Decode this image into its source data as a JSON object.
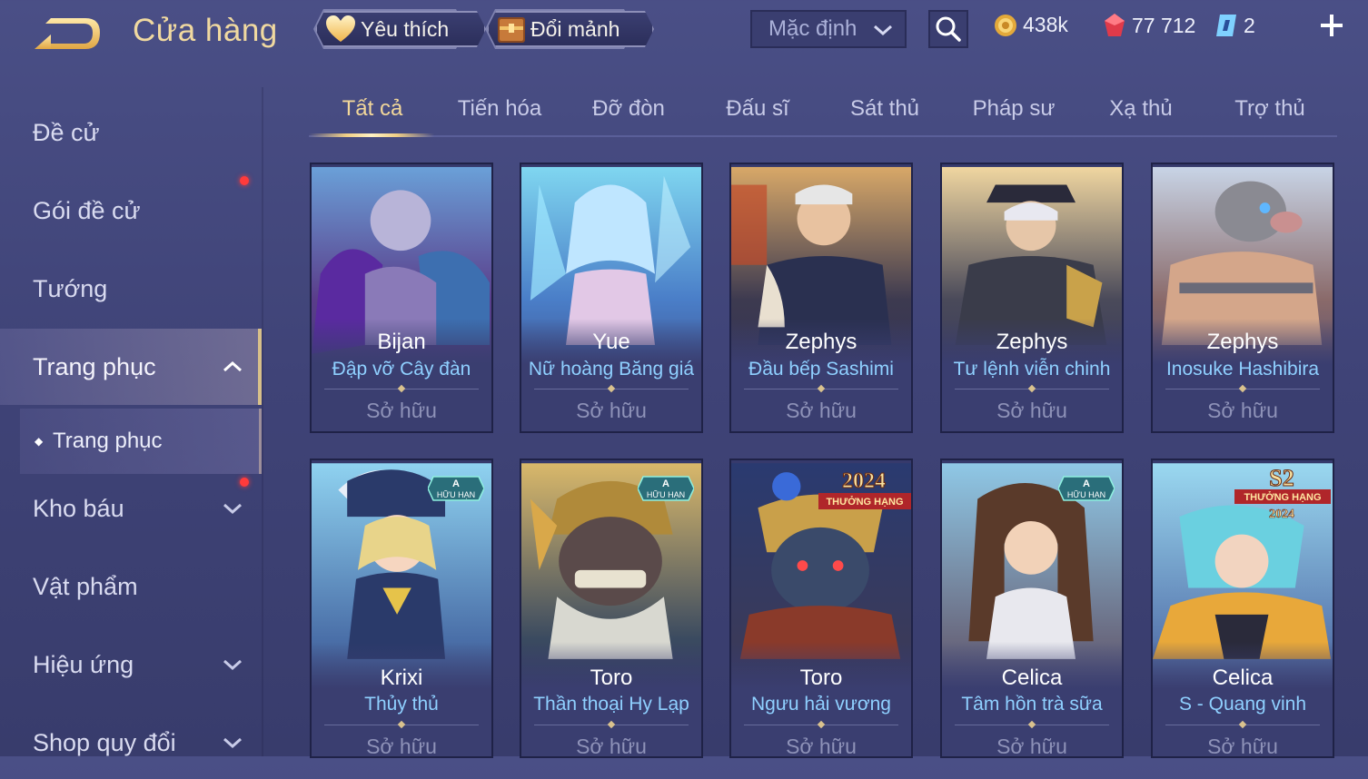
{
  "header": {
    "title": "Cửa hàng",
    "favorite_label": "Yêu thích",
    "fragment_label": "Đổi mảnh",
    "sort_value": "Mặc định",
    "gold": "438k",
    "gems": "77 712",
    "vouchers": "2"
  },
  "sidebar": {
    "items": [
      {
        "label": "Đề cử"
      },
      {
        "label": "Gói đề cử"
      },
      {
        "label": "Tướng"
      },
      {
        "label": "Trang phục"
      },
      {
        "label": "Trang phục"
      },
      {
        "label": "Kho báu"
      },
      {
        "label": "Vật phẩm"
      },
      {
        "label": "Hiệu ứng"
      },
      {
        "label": "Shop quy đổi"
      }
    ]
  },
  "tabs": [
    {
      "label": "Tất cả"
    },
    {
      "label": "Tiến hóa"
    },
    {
      "label": "Đỡ đòn"
    },
    {
      "label": "Đấu sĩ"
    },
    {
      "label": "Sát thủ"
    },
    {
      "label": "Pháp sư"
    },
    {
      "label": "Xạ thủ"
    },
    {
      "label": "Trợ thủ"
    }
  ],
  "cards": [
    {
      "hero": "Bijan",
      "skin": "Đập vỡ Cây đàn",
      "status": "Sở hữu"
    },
    {
      "hero": "Yue",
      "skin": "Nữ hoàng Băng giá",
      "status": "Sở hữu"
    },
    {
      "hero": "Zephys",
      "skin": "Đầu bếp Sashimi",
      "status": "Sở hữu"
    },
    {
      "hero": "Zephys",
      "skin": "Tư lệnh viễn chinh",
      "status": "Sở hữu"
    },
    {
      "hero": "Zephys",
      "skin": "Inosuke Hashibira",
      "status": "Sở hữu"
    },
    {
      "hero": "Krixi",
      "skin": "Thủy thủ",
      "status": "Sở hữu",
      "badge_top": "A",
      "badge_text": "HỮU HẠN"
    },
    {
      "hero": "Toro",
      "skin": "Thần thoại Hy Lạp",
      "status": "Sở hữu",
      "badge_top": "A",
      "badge_text": "HỮU HẠN"
    },
    {
      "hero": "Toro",
      "skin": "Ngưu hải vương",
      "status": "Sở hữu",
      "rank_top": "2024",
      "rank_text": "THƯỞNG HẠNG"
    },
    {
      "hero": "Celica",
      "skin": "Tâm hồn trà sữa",
      "status": "Sở hữu",
      "badge_top": "A",
      "badge_text": "HỮU HẠN"
    },
    {
      "hero": "Celica",
      "skin": "S - Quang vinh",
      "status": "Sở hữu",
      "rank_top": "S2",
      "rank_text": "THƯỞNG HẠNG",
      "rank_bottom": "2024"
    }
  ],
  "colors": {
    "accent_gold": "#f0cf86",
    "skin_name_blue": "#8fd0ff",
    "notification_red": "#ff3b3b"
  }
}
